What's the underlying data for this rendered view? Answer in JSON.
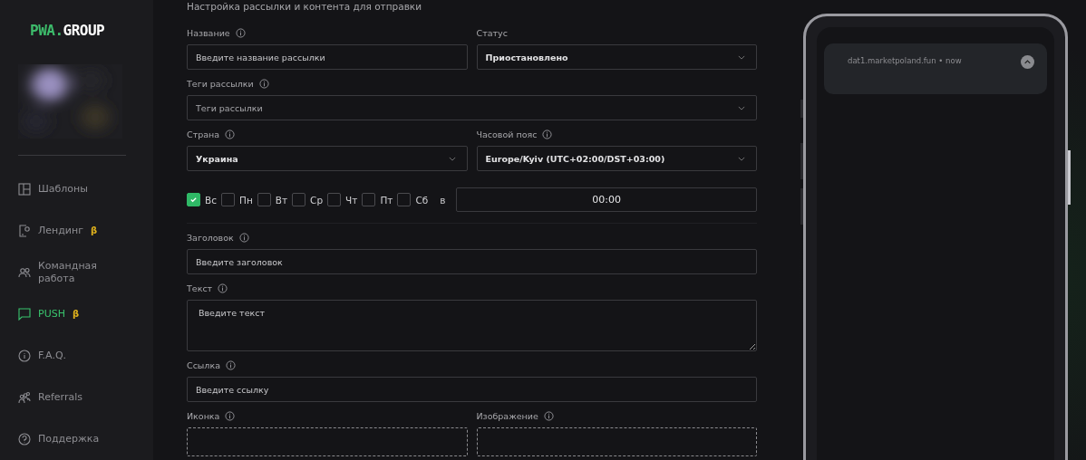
{
  "logo": {
    "accent": "PWA.",
    "text": "GROUP"
  },
  "sidebar": {
    "items": [
      {
        "label": "Шаблоны",
        "selected": false
      },
      {
        "label": "Лендинг",
        "beta": "β",
        "selected": false
      },
      {
        "label": "Командная работа",
        "selected": false
      },
      {
        "label": "PUSH",
        "beta": "β",
        "selected": true
      },
      {
        "label": "F.A.Q.",
        "selected": false
      },
      {
        "label": "Referrals",
        "selected": false
      },
      {
        "label": "Поддержка",
        "selected": false
      }
    ]
  },
  "form": {
    "heading": "Настройка рассылки и контента для отправки",
    "name": {
      "label": "Название",
      "placeholder": "Введите название рассылки"
    },
    "status": {
      "label": "Статус",
      "value": "Приостановлено"
    },
    "tags": {
      "label": "Теги рассылки",
      "placeholder": "Теги рассылки"
    },
    "country": {
      "label": "Страна",
      "value": "Украина"
    },
    "timezone": {
      "label": "Часовой пояс",
      "value": "Europe/Kyiv (UTC+02:00/DST+03:00)"
    },
    "days": [
      {
        "label": "Вс",
        "checked": true
      },
      {
        "label": "Пн",
        "checked": false
      },
      {
        "label": "Вт",
        "checked": false
      },
      {
        "label": "Ср",
        "checked": false
      },
      {
        "label": "Чт",
        "checked": false
      },
      {
        "label": "Пт",
        "checked": false
      },
      {
        "label": "Сб",
        "checked": false
      }
    ],
    "at": "в",
    "time": "00:00",
    "title": {
      "label": "Заголовок",
      "placeholder": "Введите заголовок"
    },
    "text": {
      "label": "Текст",
      "placeholder": "Введите текст"
    },
    "link": {
      "label": "Ссылка",
      "placeholder": "Введите ссылку"
    },
    "icon": {
      "label": "Иконка"
    },
    "image": {
      "label": "Изображение"
    }
  },
  "preview": {
    "notification": "dat1.marketpoland.fun • now"
  }
}
